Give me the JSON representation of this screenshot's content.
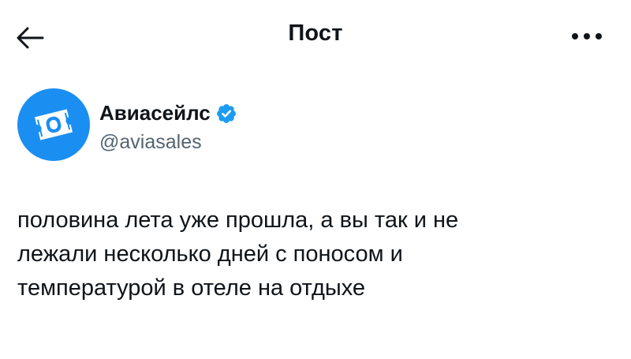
{
  "header": {
    "back_icon": "arrow-left-icon",
    "title": "Пост",
    "more_icon": "more-horizontal-icon"
  },
  "author": {
    "name": "Авиасейлс",
    "handle": "@aviasales",
    "verified": true,
    "avatar_icon": "ticket-logo-icon",
    "avatar_color": "#1b8ef2",
    "verified_color": "#1d9bf0"
  },
  "tweet": {
    "lines": [
      "половина лета уже прошла, а вы так и не",
      "лежали несколько дней с поносом и",
      "температурой в отеле на отдыхе"
    ]
  }
}
